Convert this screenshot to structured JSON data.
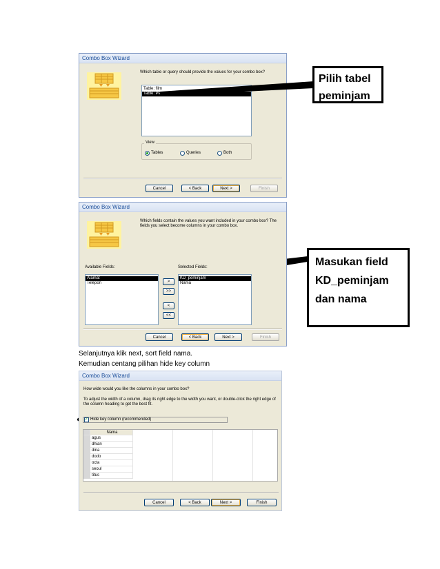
{
  "wizard1": {
    "title": "Combo Box Wizard",
    "prompt": "Which table or query should provide the values for your combo box?",
    "list": [
      "Table: film",
      "Table: Peminjam"
    ],
    "view_label": "View",
    "view_options": [
      "Tables",
      "Queries",
      "Both"
    ],
    "selected_view": "Tables",
    "buttons": {
      "cancel": "Cancel",
      "back": "< Back",
      "next": "Next >",
      "finish": "Finish"
    }
  },
  "callout1": {
    "line1": "Pilih tabel",
    "line2": "peminjam"
  },
  "wizard2": {
    "title": "Combo Box Wizard",
    "prompt": "Which fields contain the values you want included in your combo box? The fields you select become columns in your combo box.",
    "available_label": "Available Fields:",
    "available": [
      "Alamat",
      "Telepon"
    ],
    "selected_label": "Selected Fields:",
    "selected": [
      "KD_peminjam",
      "Nama"
    ],
    "move_buttons": [
      ">",
      ">>",
      "<",
      "<<"
    ],
    "buttons": {
      "cancel": "Cancel",
      "back": "< Back",
      "next": "Next >",
      "finish": "Finish"
    }
  },
  "callout2": {
    "line1": "Masukan field",
    "line2": "KD_peminjam",
    "line3": "dan nama"
  },
  "body_text": {
    "line1": "Selanjutnya klik next, sort field nama.",
    "line2": "Kemudian centang pilihan hide key column"
  },
  "wizard3": {
    "title": "Combo Box Wizard",
    "prompt": "How wide would you like the columns in your combo box?",
    "instructions": "To adjust the width of a column, drag its right edge to the width you want, or double-click the right edge of the column heading to get the best fit.",
    "hide_key_label": "Hide key column (recommended)",
    "hide_key_checked": true,
    "column_header": "Nama",
    "rows": [
      "agus",
      "dhian",
      "dina",
      "dodo",
      "octa",
      "seoul",
      "titus"
    ],
    "buttons": {
      "cancel": "Cancel",
      "back": "< Back",
      "next": "Next >",
      "finish": "Finish"
    }
  },
  "colors": {
    "dialog_bg": "#ECE9D8",
    "title_text": "#1a4d99",
    "selection": "#000000"
  }
}
